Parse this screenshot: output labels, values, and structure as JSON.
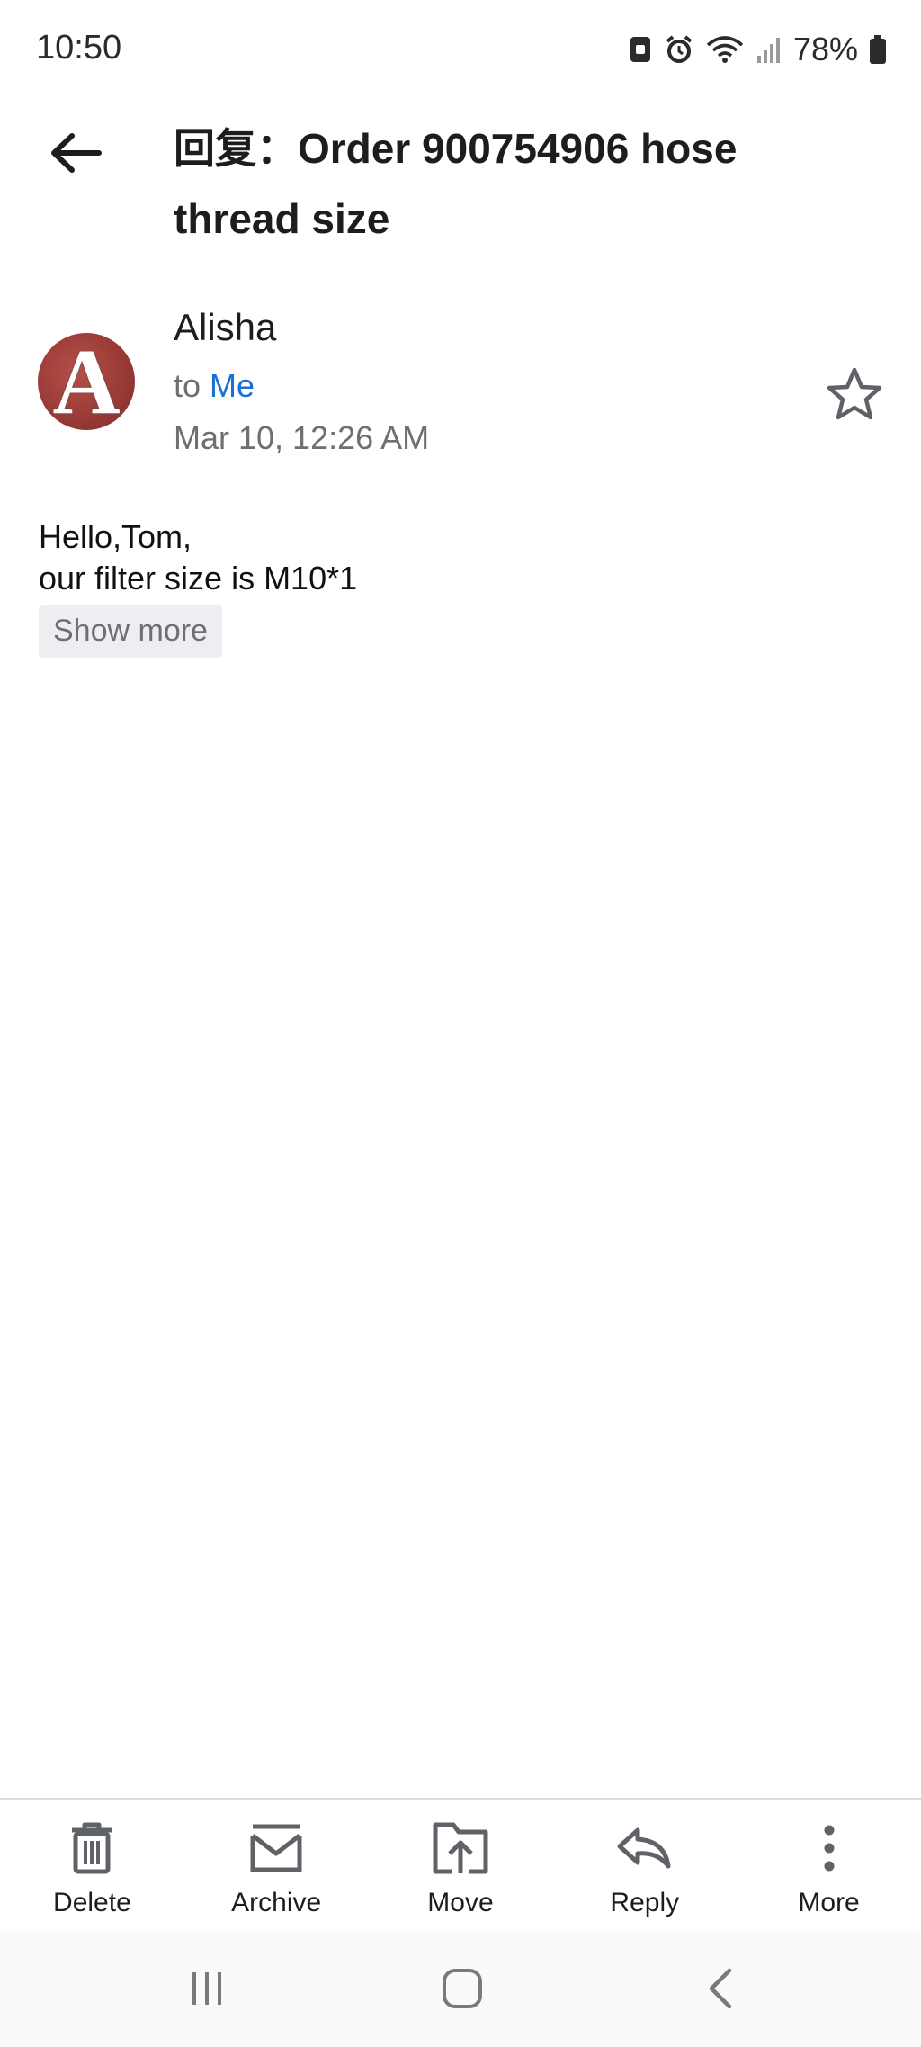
{
  "status_bar": {
    "time": "10:50",
    "battery": "78%",
    "icons": [
      "sim-icon",
      "alarm-icon",
      "wifi-icon",
      "signal-icon",
      "battery-icon"
    ]
  },
  "email": {
    "subject": "回复：Order 900754906 hose thread size",
    "sender": "Alisha",
    "avatar_letter": "A",
    "to_label": "to",
    "recipient": "Me",
    "date": "Mar 10, 12:26 AM",
    "body_lines": [
      "Hello,Tom,",
      "our filter size is M10*1"
    ],
    "show_more": "Show more"
  },
  "actions": [
    {
      "label": "Delete",
      "icon": "trash-icon"
    },
    {
      "label": "Archive",
      "icon": "archive-icon"
    },
    {
      "label": "Move",
      "icon": "move-icon"
    },
    {
      "label": "Reply",
      "icon": "reply-icon"
    },
    {
      "label": "More",
      "icon": "more-vertical-icon"
    }
  ],
  "nav": [
    "recent-apps-icon",
    "home-icon",
    "back-nav-icon"
  ],
  "colors": {
    "accent": "#1a6fd6",
    "muted": "#6e6e73"
  }
}
